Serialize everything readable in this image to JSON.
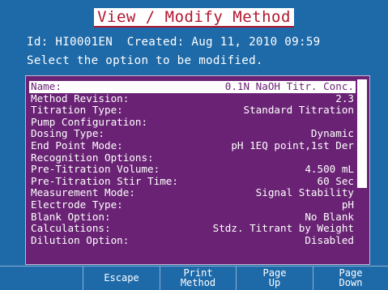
{
  "header": {
    "title": "View / Modify Method"
  },
  "info": {
    "line1": "Id: HI0001EN  Created: Aug 11, 2010 09:59",
    "line2": "Select the option to be modified."
  },
  "options": [
    {
      "label": "Name:",
      "value": "0.1N NaOH Titr. Conc.",
      "selected": true
    },
    {
      "label": "Method Revision:",
      "value": "2.3"
    },
    {
      "label": "Titration Type:",
      "value": "Standard Titration"
    },
    {
      "label": "Pump Configuration:",
      "value": ""
    },
    {
      "label": "Dosing Type:",
      "value": "Dynamic"
    },
    {
      "label": "End Point Mode:",
      "value": "pH 1EQ point,1st Der"
    },
    {
      "label": "Recognition Options:",
      "value": ""
    },
    {
      "label": "Pre-Titration Volume:",
      "value": "4.500 mL"
    },
    {
      "label": "Pre-Titration Stir Time:",
      "value": "60 Sec"
    },
    {
      "label": "Measurement Mode:",
      "value": "Signal Stability"
    },
    {
      "label": "Electrode Type:",
      "value": "pH"
    },
    {
      "label": "Blank Option:",
      "value": "No Blank"
    },
    {
      "label": "Calculations:",
      "value": "Stdz. Titrant by Weight"
    },
    {
      "label": "Dilution Option:",
      "value": "Disabled"
    }
  ],
  "scrollbar": {
    "thumb_start": 0.6,
    "thumb_end": 1.0
  },
  "softkeys": {
    "key1": [
      ""
    ],
    "key2": [
      "Escape"
    ],
    "key3": [
      "Print",
      "Method"
    ],
    "key4": [
      "Page",
      "Up"
    ],
    "key5": [
      "Page",
      "Down"
    ]
  },
  "colors": {
    "background": "#1e6aa9",
    "list_background": "#6a2374",
    "title_text": "#b0172f"
  }
}
